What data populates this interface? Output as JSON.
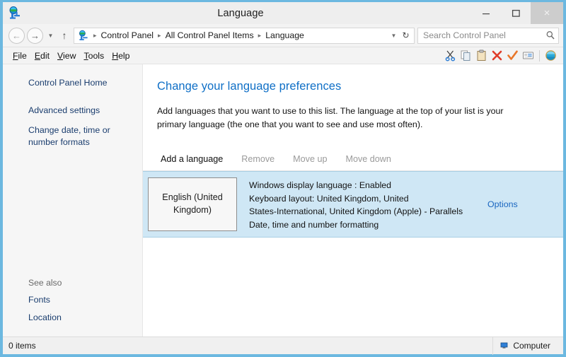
{
  "window": {
    "title": "Language",
    "app_icon": "language-globe-icon",
    "controls": {
      "minimize": "minimize-icon",
      "maximize": "maximize-icon",
      "close": "close-icon",
      "close_glyph": "×"
    },
    "border_color": "#6cb8e0"
  },
  "navbar": {
    "back": "back-arrow-icon",
    "forward": "forward-arrow-icon",
    "recent": "recent-locations-chevron-icon",
    "up": "up-arrow-icon",
    "address_icon": "language-globe-icon",
    "breadcrumbs": [
      "Control Panel",
      "All Control Panel Items",
      "Language"
    ],
    "breadcrumb_separator": "▸",
    "dropdown": "chevron-down-icon",
    "refresh": "refresh-icon",
    "refresh_glyph": "↻"
  },
  "search": {
    "placeholder": "Search Control Panel",
    "value": "",
    "icon": "search-icon"
  },
  "menubar": {
    "items": [
      {
        "accel": "F",
        "rest": "ile"
      },
      {
        "accel": "E",
        "rest": "dit"
      },
      {
        "accel": "V",
        "rest": "iew"
      },
      {
        "accel": "T",
        "rest": "ools"
      },
      {
        "accel": "H",
        "rest": "elp"
      }
    ],
    "toolbar_icons": [
      "cut-scissors-icon",
      "copy-icon",
      "paste-clipboard-icon",
      "delete-x-icon",
      "confirm-check-icon",
      "rename-card-icon",
      "globe-icon"
    ]
  },
  "sidebar": {
    "home_label": "Control Panel Home",
    "links": [
      "Advanced settings",
      "Change date, time or number formats"
    ],
    "see_also_label": "See also",
    "see_also_links": [
      "Fonts",
      "Location"
    ]
  },
  "main": {
    "title": "Change your language preferences",
    "description": "Add languages that you want to use to this list. The language at the top of your list is your primary language (the one that you want to see and use most often).",
    "commands": [
      {
        "label": "Add a language",
        "enabled": true
      },
      {
        "label": "Remove",
        "enabled": false
      },
      {
        "label": "Move up",
        "enabled": false
      },
      {
        "label": "Move down",
        "enabled": false
      }
    ],
    "languages": [
      {
        "name": "English (United Kingdom)",
        "details": [
          "Windows display language : Enabled",
          "Keyboard layout: United Kingdom, United",
          "States-International, United Kingdom (Apple) - Parallels",
          "Date, time and number formatting"
        ],
        "options_label": "Options",
        "selected": true
      }
    ]
  },
  "statusbar": {
    "items_text": "0 items",
    "location_icon": "computer-icon",
    "location_text": "Computer",
    "grip": "resize-grip-icon"
  },
  "colors": {
    "accent_blue": "#0f6fc6",
    "link_blue": "#1a3d6e",
    "selection_blue": "#cfe7f5",
    "window_border": "#6cb8e0"
  }
}
